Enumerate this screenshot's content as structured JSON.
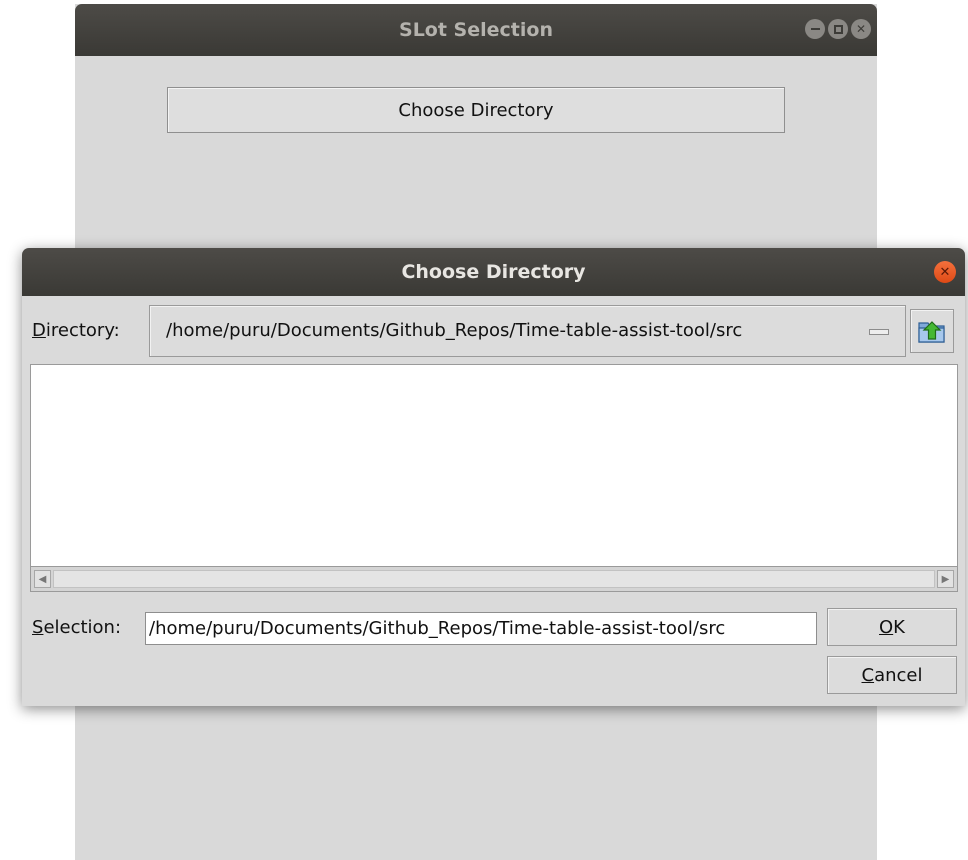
{
  "main_window": {
    "title": "SLot Selection",
    "choose_directory_label": "Choose Directory"
  },
  "dialog": {
    "title": "Choose Directory",
    "directory_label_first": "D",
    "directory_label_rest": "irectory:",
    "directory_value": "/home/puru/Documents/Github_Repos/Time-table-assist-tool/src",
    "selection_label_first": "S",
    "selection_label_rest": "election:",
    "selection_value": "/home/puru/Documents/Github_Repos/Time-table-assist-tool/src",
    "ok_label_first": "O",
    "ok_label_rest": "K",
    "cancel_label_first": "C",
    "cancel_label_rest": "ancel",
    "files": []
  },
  "icons": {
    "folder_up": "folder-up-icon",
    "close": "close-icon",
    "minimize": "minimize-icon",
    "maximize": "maximize-icon"
  },
  "colors": {
    "titlebar": "#3a3935",
    "close_button": "#e8541f",
    "window_background": "#d9d9d9"
  }
}
